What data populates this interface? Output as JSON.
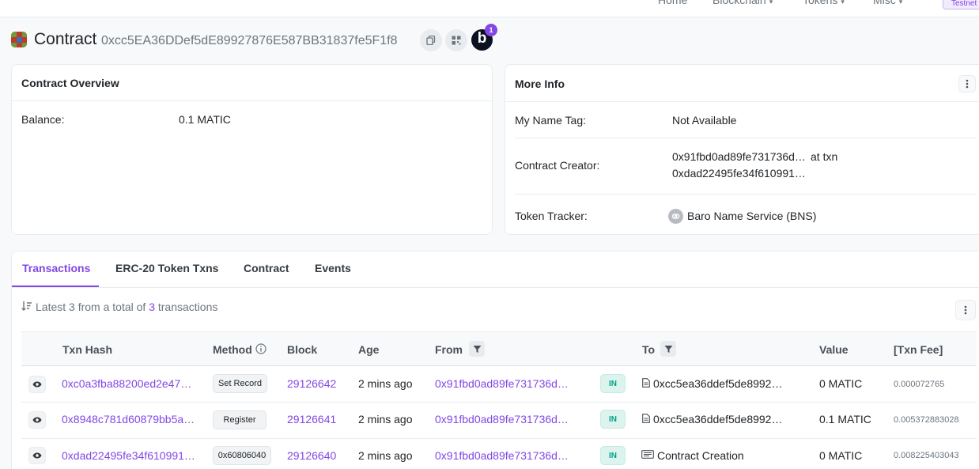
{
  "nav": {
    "home": "Home",
    "blockchain": "Blockchain",
    "tokens": "Tokens",
    "misc": "Misc",
    "testnet": "Testnet"
  },
  "header": {
    "title": "Contract",
    "address": "0xcc5EA36DDef5dE89927876E587BB31837fe5F1f8",
    "b_label": "b",
    "b_badge": "1"
  },
  "overview": {
    "title": "Contract Overview",
    "balance_label": "Balance:",
    "balance_value": "0.1 MATIC"
  },
  "more_info": {
    "title": "More Info",
    "name_tag_label": "My Name Tag:",
    "name_tag_value": "Not Available",
    "creator_label": "Contract Creator:",
    "creator_address": "0x91fbd0ad89fe731736d…",
    "at_txn": "at txn",
    "creator_txn": "0xdad22495fe34f610991…",
    "tracker_label": "Token Tracker:",
    "tracker_value": "Baro Name Service (BNS)"
  },
  "tabs": [
    "Transactions",
    "ERC-20 Token Txns",
    "Contract",
    "Events"
  ],
  "summary": {
    "prefix": "Latest 3 from a total of",
    "count": "3",
    "suffix": "transactions"
  },
  "table": {
    "columns": {
      "txn_hash": "Txn Hash",
      "method": "Method",
      "block": "Block",
      "age": "Age",
      "from": "From",
      "to": "To",
      "value": "Value",
      "fee": "[Txn Fee]"
    },
    "rows": [
      {
        "hash": "0xc0a3fba88200ed2e47…",
        "method": "Set Record",
        "block": "29126642",
        "age": "2 mins ago",
        "from": "0x91fbd0ad89fe731736d…",
        "direction": "IN",
        "to": "0xcc5ea36ddef5de8992…",
        "value": "0 MATIC",
        "fee": "0.000072765"
      },
      {
        "hash": "0x8948c781d60879bb5a…",
        "method": "Register",
        "block": "29126641",
        "age": "2 mins ago",
        "from": "0x91fbd0ad89fe731736d…",
        "direction": "IN",
        "to": "0xcc5ea36ddef5de8992…",
        "value": "0.1 MATIC",
        "fee": "0.005372883028"
      },
      {
        "hash": "0xdad22495fe34f610991…",
        "method": "0x60806040",
        "block": "29126640",
        "age": "2 mins ago",
        "from": "0x91fbd0ad89fe731736d…",
        "direction": "IN",
        "to": "Contract Creation",
        "value": "0 MATIC",
        "fee": "0.008225403043"
      }
    ]
  },
  "colors": {
    "accent": "#8247e5",
    "in_badge": "#00a186"
  }
}
